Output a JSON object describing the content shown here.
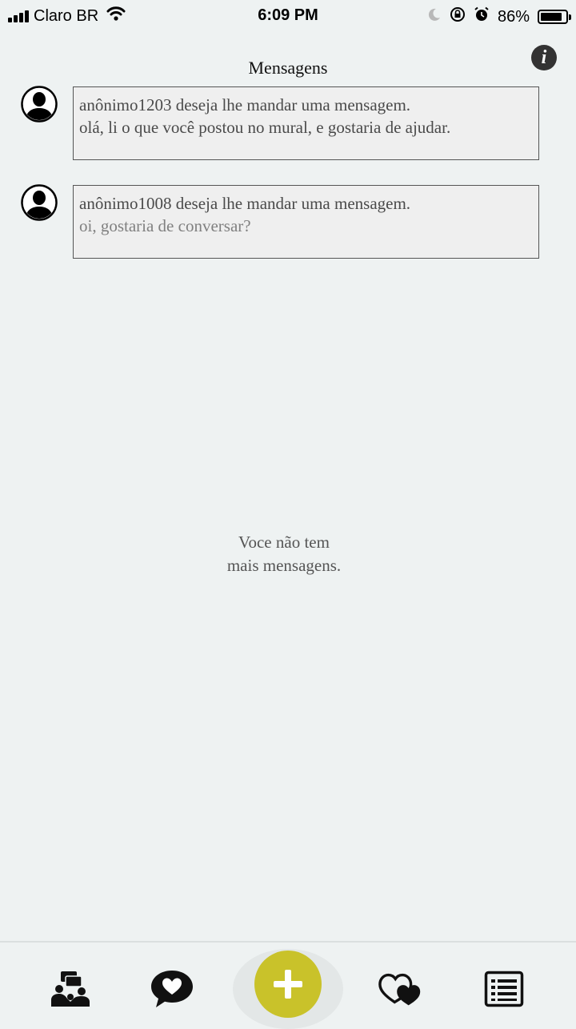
{
  "status_bar": {
    "carrier": "Claro BR",
    "time": "6:09 PM",
    "battery_percent": "86%",
    "battery_level": 0.86,
    "icons": [
      "signal-icon",
      "wifi-icon",
      "moon-icon",
      "rotation-lock-icon",
      "alarm-icon",
      "battery-icon"
    ]
  },
  "header": {
    "title": "Mensagens",
    "info_icon": "info-icon"
  },
  "messages": [
    {
      "title": "anônimo1203 deseja lhe mandar uma mensagem.",
      "text": "olá, li o que você postou no mural, e gostaria de ajudar.",
      "text_color": "#4a4a4a"
    },
    {
      "title": "anônimo1008 deseja lhe mandar uma mensagem.",
      "text": "oi, gostaria de conversar?",
      "text_color": "#808080"
    }
  ],
  "empty_state": {
    "line1": "Voce não tem",
    "line2": "mais mensagens."
  },
  "bottom_nav": {
    "items": [
      "community-icon",
      "heart-chat-icon",
      "add-icon",
      "hearts-icon",
      "list-icon"
    ],
    "accent_color": "#c9c22a"
  }
}
